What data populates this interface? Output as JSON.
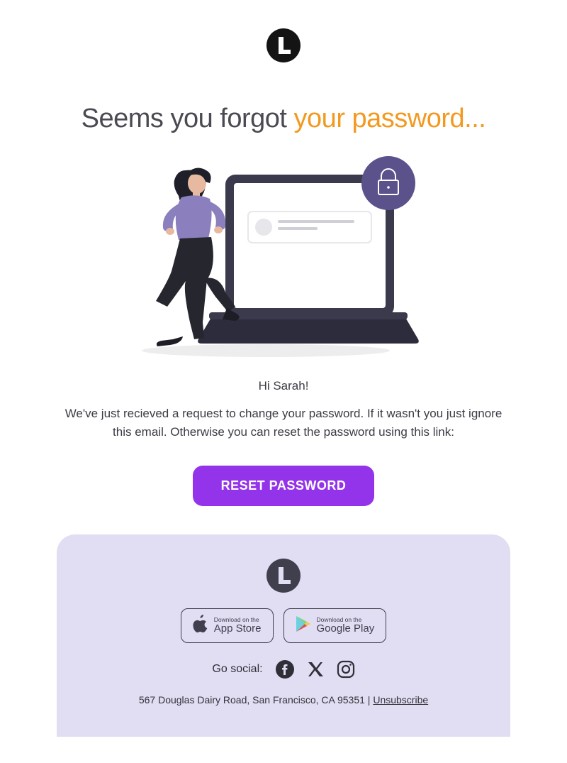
{
  "header": {
    "logo_letter": "L"
  },
  "heading": {
    "part1": "Seems you forgot ",
    "part2": "your password..."
  },
  "greeting": "Hi Sarah!",
  "body_text": "We've just recieved a request to change your password. If it wasn't you just ignore this email. Otherwise you can reset the password using this link:",
  "cta_label": "RESET PASSWORD",
  "footer": {
    "logo_letter": "L",
    "appstore": {
      "small": "Download on the",
      "big": "App Store"
    },
    "googleplay": {
      "small": "Download on the",
      "big": "Google Play"
    },
    "social_label": "Go social:",
    "address": "567 Douglas Dairy Road, San Francisco, CA 95351 | ",
    "unsubscribe": "Unsubscribe"
  },
  "colors": {
    "accent_orange": "#f29a1f",
    "cta_purple": "#9333ea",
    "footer_lavender": "#e1ddf2",
    "logo_dark": "#141414",
    "footer_logo": "#3f3f4d"
  }
}
